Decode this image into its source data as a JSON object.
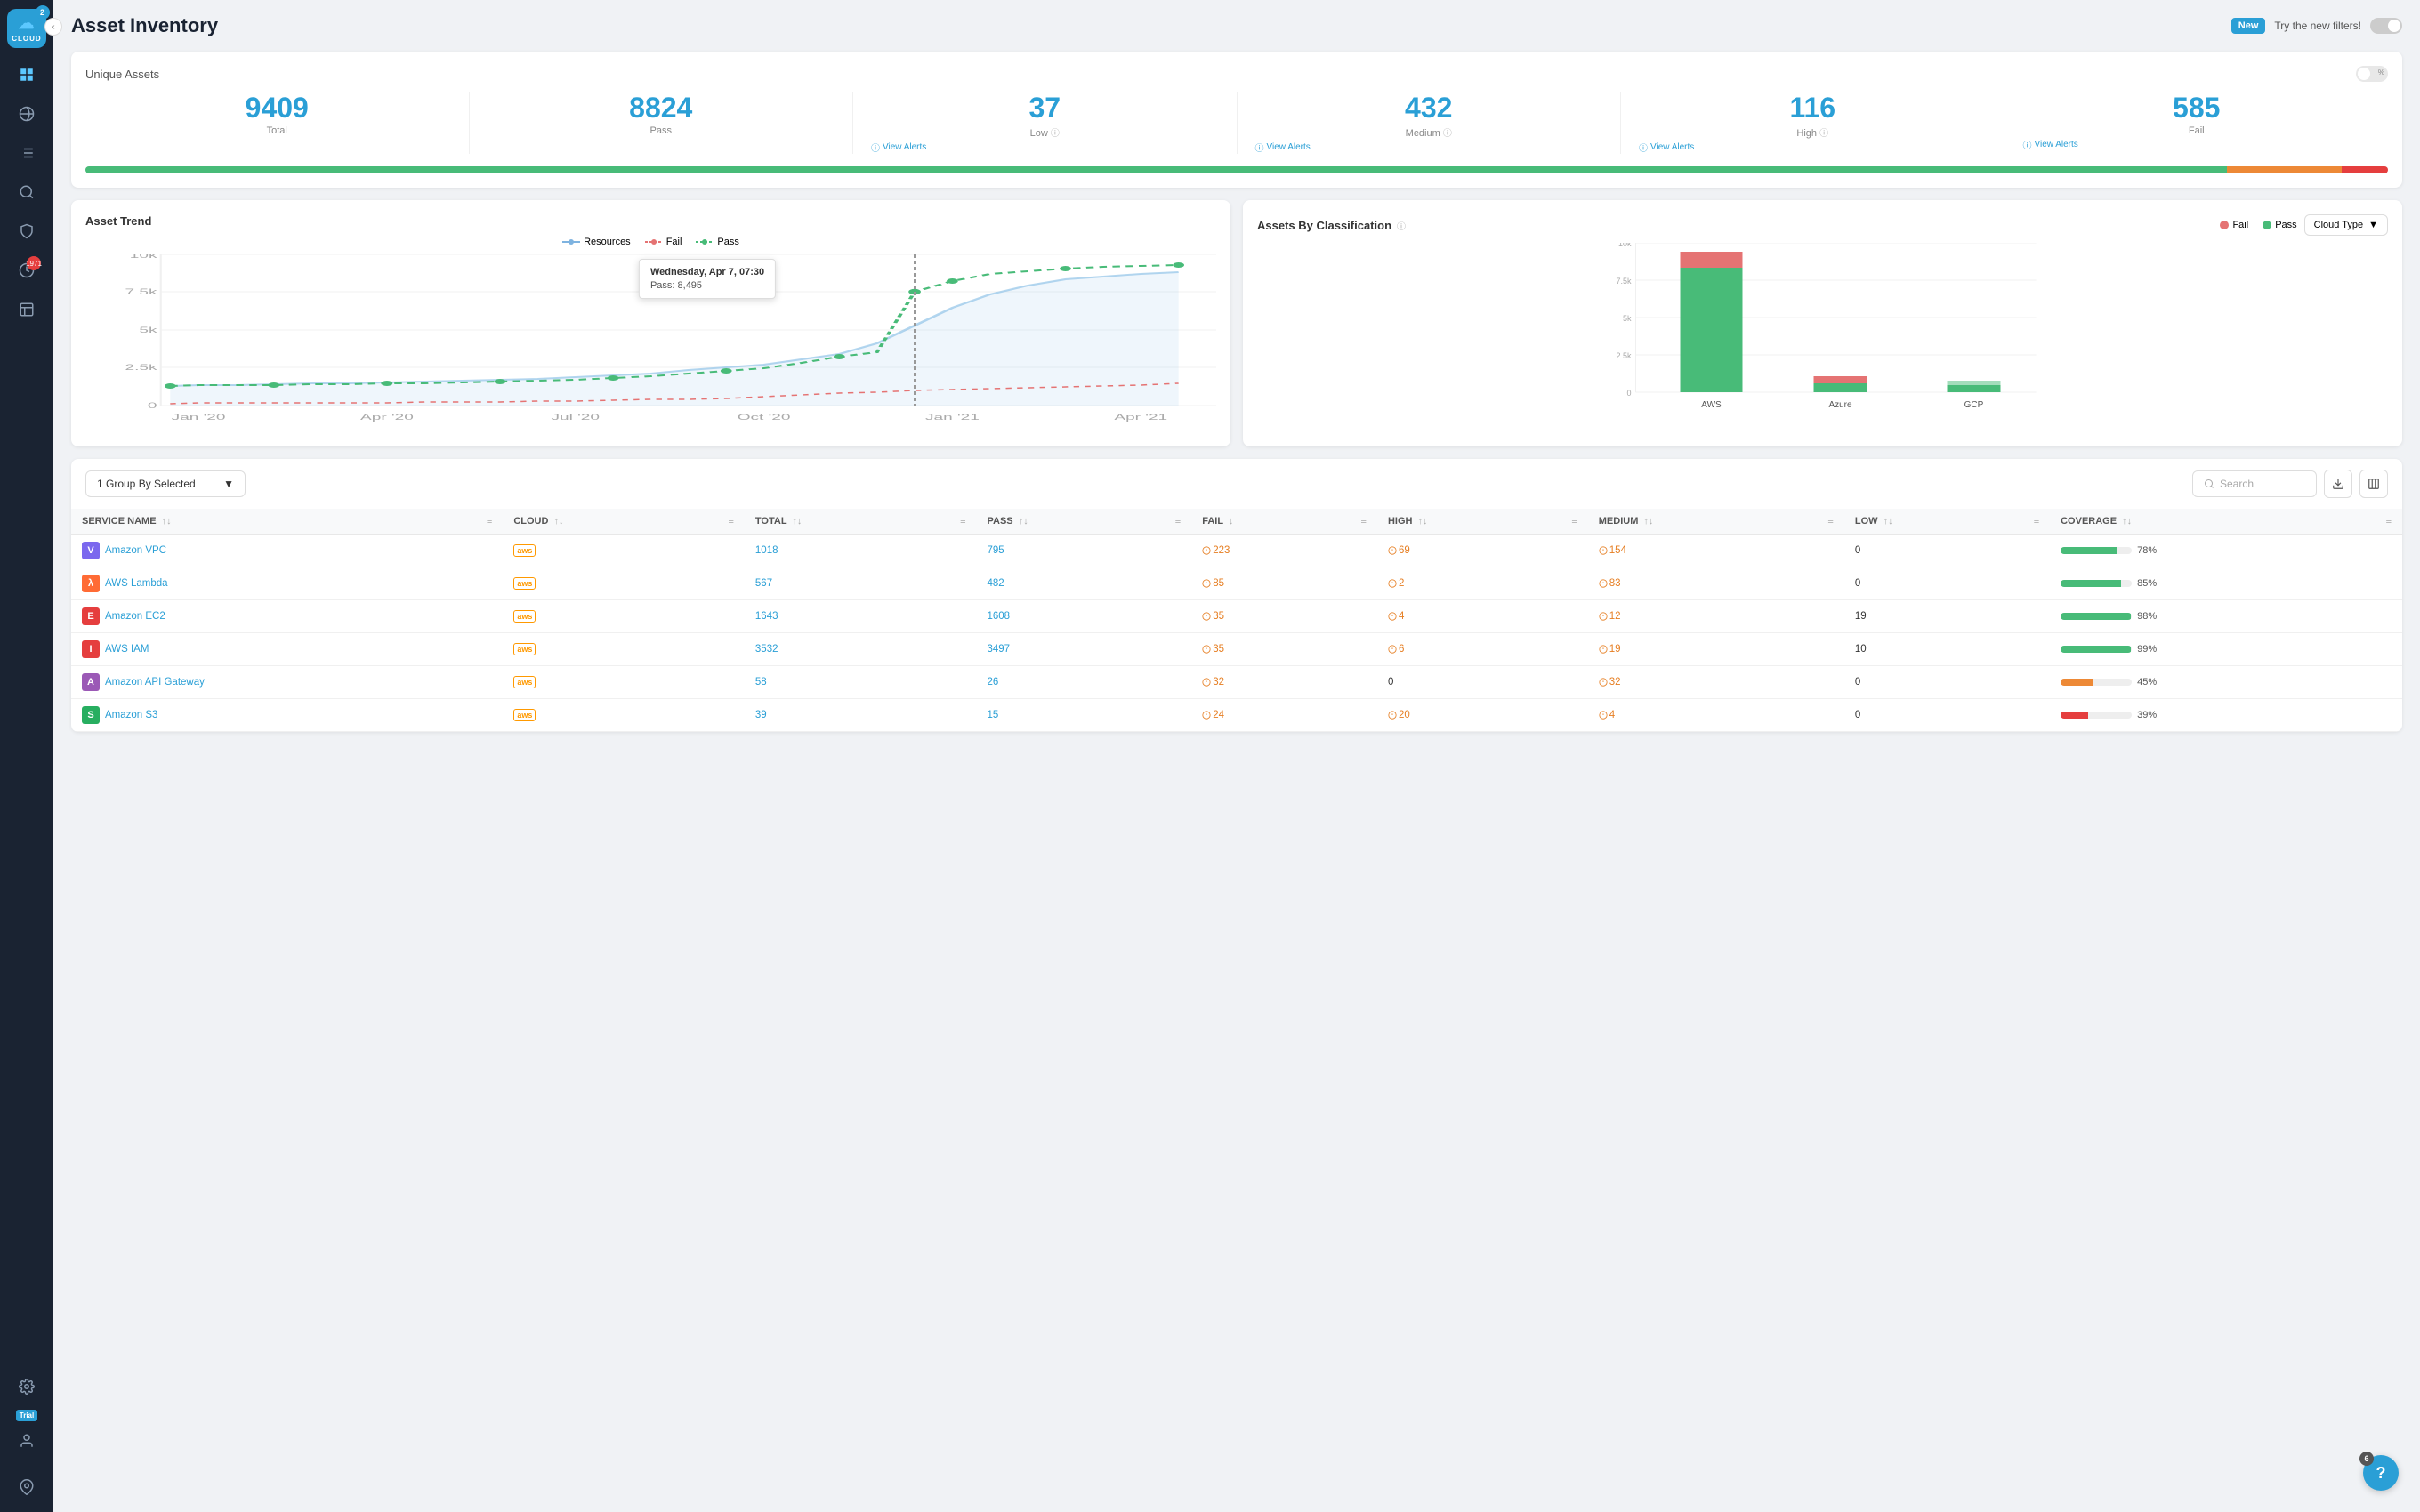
{
  "page": {
    "title": "Asset Inventory"
  },
  "header": {
    "new_label": "New",
    "try_label": "Try the new filters!"
  },
  "sidebar": {
    "app_name": "CLOUD",
    "notification_count": "2",
    "alert_count": "1971",
    "trial_label": "Trial"
  },
  "unique_assets": {
    "section_label": "Unique Assets",
    "total": "9409",
    "total_label": "Total",
    "pass": "8824",
    "pass_label": "Pass",
    "low": "37",
    "low_label": "Low",
    "medium": "432",
    "medium_label": "Medium",
    "high": "116",
    "high_label": "High",
    "fail": "585",
    "fail_label": "Fail",
    "view_alerts": "View Alerts",
    "progress_green_pct": 93,
    "progress_orange_pct": 5,
    "progress_red_pct": 2
  },
  "asset_trend": {
    "title": "Asset Trend",
    "legend": {
      "resources": "Resources",
      "fail": "Fail",
      "pass": "Pass"
    },
    "tooltip": {
      "title": "Wednesday, Apr 7, 07:30",
      "value": "Pass: 8,495"
    },
    "y_labels": [
      "0",
      "2.5k",
      "5k",
      "7.5k",
      "10k"
    ],
    "x_labels": [
      "Jan '20",
      "Apr '20",
      "Jul '20",
      "Oct '20",
      "Jan '21",
      "Apr '21"
    ]
  },
  "assets_by_classification": {
    "title": "Assets By Classification",
    "legend": {
      "fail": "Fail",
      "pass": "Pass"
    },
    "cloud_type_label": "Cloud Type",
    "bars": [
      {
        "label": "AWS",
        "pass_height": 75,
        "fail_height": 10
      },
      {
        "label": "Azure",
        "pass_height": 4,
        "fail_height": 3
      },
      {
        "label": "GCP",
        "pass_height": 3,
        "fail_height": 1
      }
    ],
    "y_labels": [
      "0",
      "2.5k",
      "5k",
      "7.5k",
      "10k"
    ]
  },
  "table": {
    "group_by_label": "1 Group By Selected",
    "search_placeholder": "Search",
    "columns": [
      "SERVICE NAME",
      "CLOUD",
      "TOTAL",
      "PASS",
      "FAIL",
      "HIGH",
      "MEDIUM",
      "LOW",
      "COVERAGE"
    ],
    "rows": [
      {
        "service": "Amazon VPC",
        "icon_color": "#7b68ee",
        "icon_letter": "V",
        "cloud": "aws",
        "total": "1018",
        "pass": "795",
        "fail": "223",
        "high": "69",
        "medium": "154",
        "low": "0",
        "coverage": 78,
        "coverage_color": "green"
      },
      {
        "service": "AWS Lambda",
        "icon_color": "#ff6b35",
        "icon_letter": "λ",
        "cloud": "aws",
        "total": "567",
        "pass": "482",
        "fail": "85",
        "high": "2",
        "medium": "83",
        "low": "0",
        "coverage": 85,
        "coverage_color": "green"
      },
      {
        "service": "Amazon EC2",
        "icon_color": "#e53e3e",
        "icon_letter": "E",
        "cloud": "aws",
        "total": "1643",
        "pass": "1608",
        "fail": "35",
        "high": "4",
        "medium": "12",
        "low": "19",
        "coverage": 98,
        "coverage_color": "green"
      },
      {
        "service": "AWS IAM",
        "icon_color": "#e53e3e",
        "icon_letter": "I",
        "cloud": "aws",
        "total": "3532",
        "pass": "3497",
        "fail": "35",
        "high": "6",
        "medium": "19",
        "low": "10",
        "coverage": 99,
        "coverage_color": "green"
      },
      {
        "service": "Amazon API Gateway",
        "icon_color": "#9b59b6",
        "icon_letter": "A",
        "cloud": "aws",
        "total": "58",
        "pass": "26",
        "fail": "32",
        "high": "0",
        "medium": "32",
        "low": "0",
        "coverage": 45,
        "coverage_color": "orange"
      },
      {
        "service": "Amazon S3",
        "icon_color": "#27ae60",
        "icon_letter": "S",
        "cloud": "aws",
        "total": "39",
        "pass": "15",
        "fail": "24",
        "high": "20",
        "medium": "4",
        "low": "0",
        "coverage": 39,
        "coverage_color": "red"
      }
    ]
  },
  "help": {
    "count": "6",
    "symbol": "?"
  }
}
